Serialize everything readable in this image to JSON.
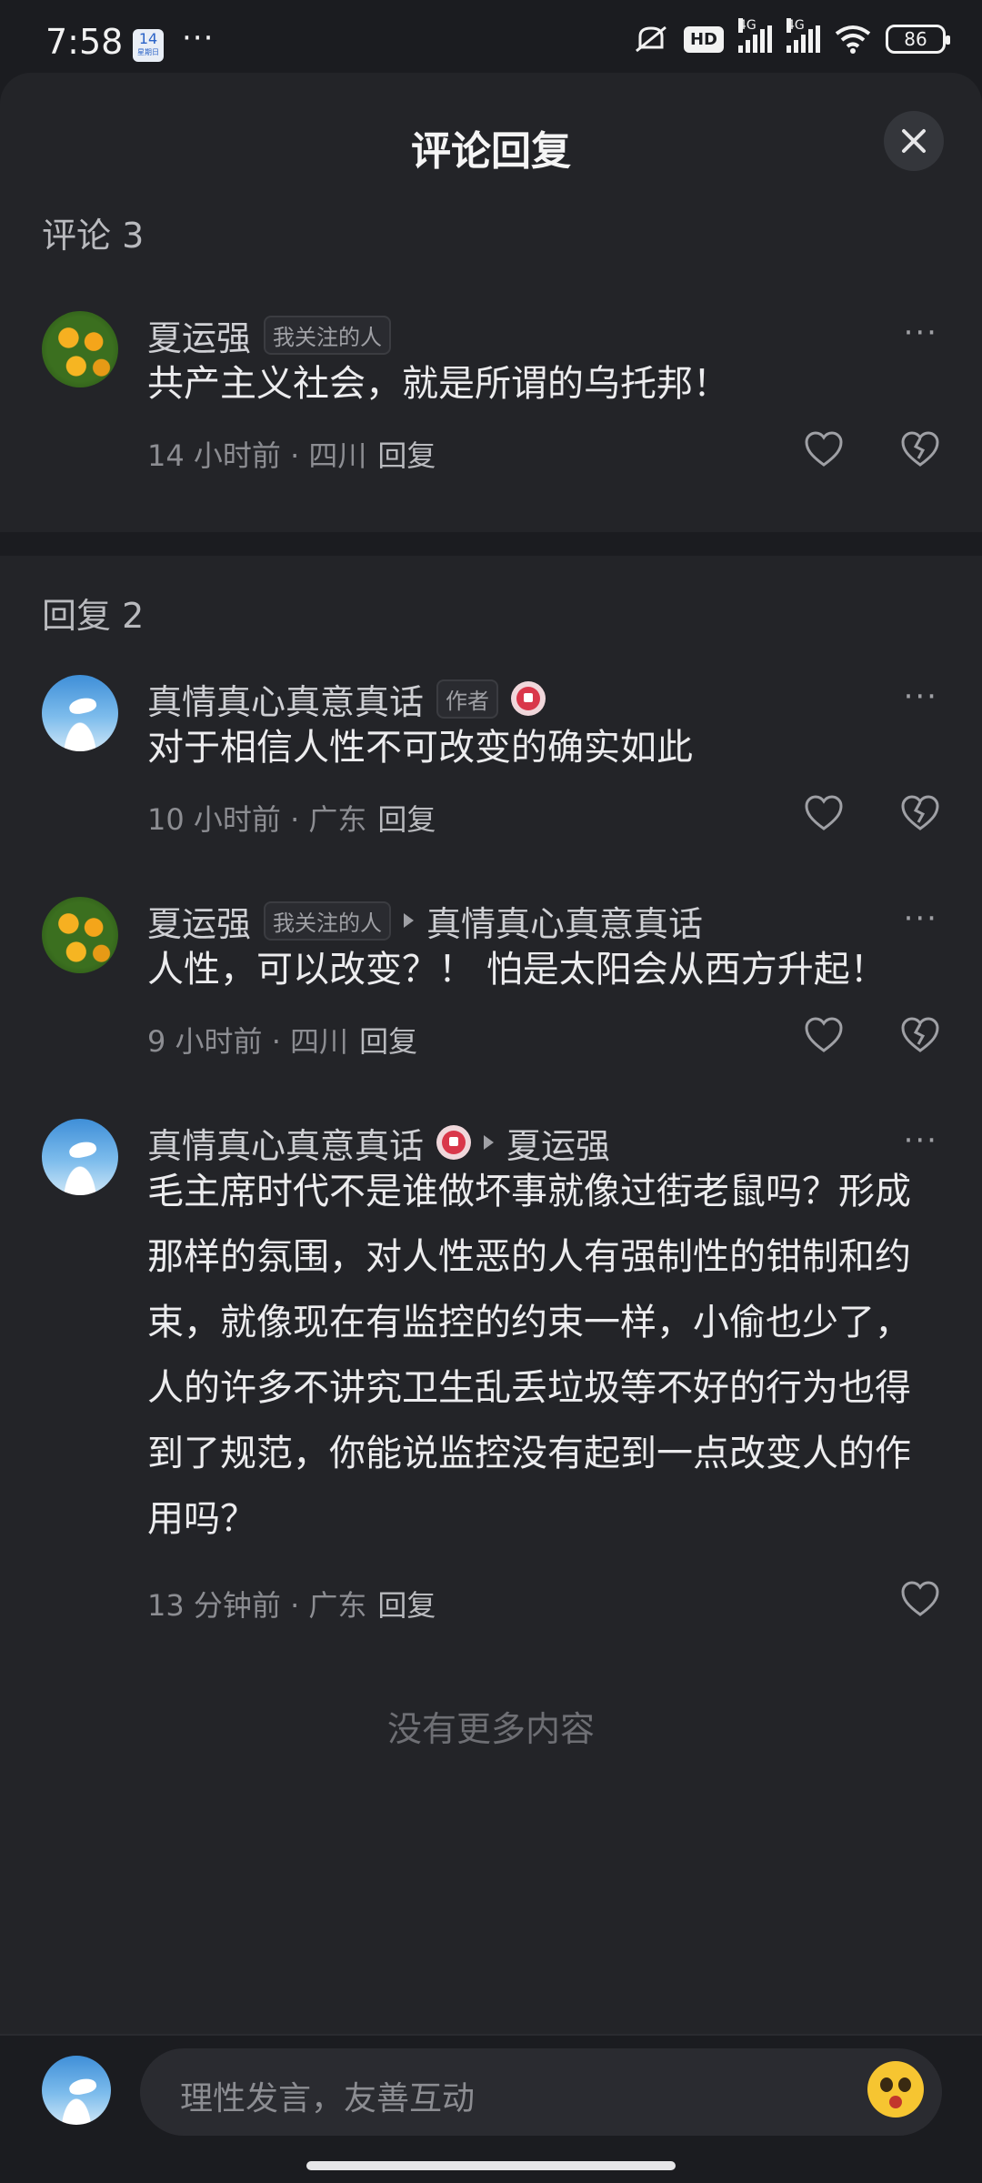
{
  "status_bar": {
    "time": "7:58",
    "calendar_day": "14",
    "calendar_sub": "星期日",
    "dots": "···",
    "hd": "HD",
    "net1": "4G",
    "net2": "4G",
    "battery": "86"
  },
  "sheet": {
    "title": "评论回复"
  },
  "comment_section": {
    "label": "评论 3",
    "comment": {
      "name": "夏运强",
      "tag": "我关注的人",
      "text": "共产主义社会，就是所谓的乌托邦！",
      "meta": "14 小时前 · 四川",
      "reply_label": "回复"
    }
  },
  "replies_section": {
    "label": "回复 2",
    "replies": [
      {
        "name": "真情真心真意真话",
        "tag": "作者",
        "text": "对于相信人性不可改变的确实如此",
        "meta": "10 小时前 · 广东",
        "reply_label": "回复"
      },
      {
        "name": "夏运强",
        "tag": "我关注的人",
        "reply_to": "真情真心真意真话",
        "text": "人性，可以改变？！ 怕是太阳会从西方升起！",
        "meta": "9 小时前 · 四川",
        "reply_label": "回复"
      },
      {
        "name": "真情真心真意真话",
        "reply_to": "夏运强",
        "text": "毛主席时代不是谁做坏事就像过街老鼠吗？形成那样的氛围，对人性恶的人有强制性的钳制和约束，就像现在有监控的约束一样，小偷也少了，人的许多不讲究卫生乱丢垃圾等不好的行为也得到了规范，你能说监控没有起到一点改变人的作用吗？",
        "meta": "13 分钟前 · 广东",
        "reply_label": "回复"
      }
    ]
  },
  "footer": {
    "no_more": "没有更多内容",
    "input_placeholder": "理性发言，友善互动"
  },
  "colors": {
    "background": "#232428",
    "text_primary": "#ececee",
    "text_secondary": "#8c8d92",
    "badge_red": "#d9374a"
  }
}
